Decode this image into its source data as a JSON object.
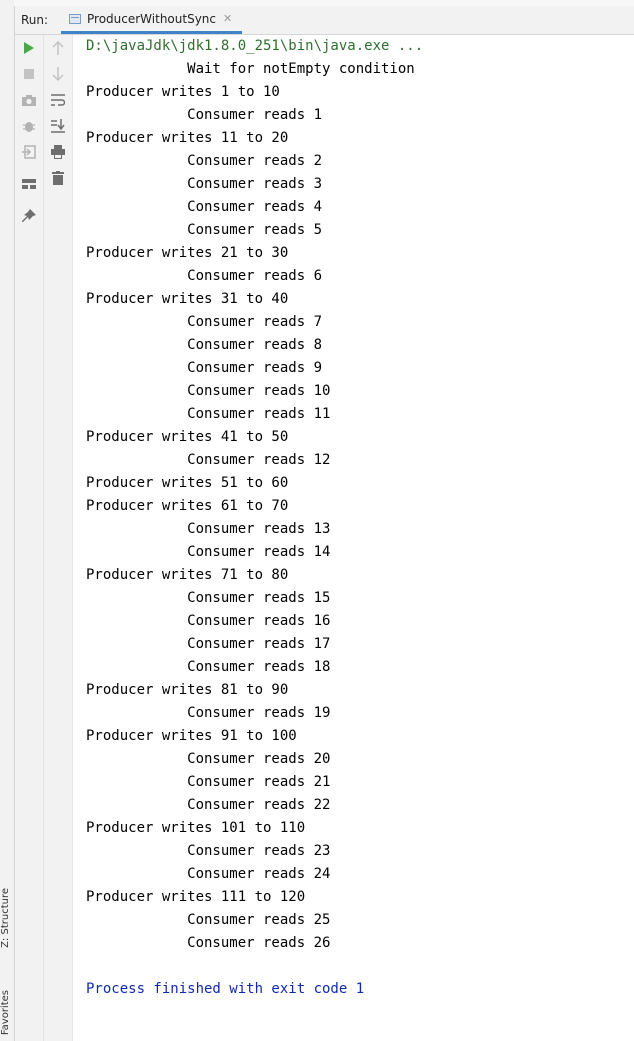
{
  "side_tabs": {
    "structure": "Z: Structure",
    "favorites": "Favorites"
  },
  "header": {
    "run_label": "Run:",
    "tab_label": "ProducerWithoutSync"
  },
  "toolbar": {
    "primary": [
      "run-icon",
      "stop-icon",
      "camera-icon",
      "debug-icon",
      "exit-icon",
      "layout-icon",
      "pin-icon"
    ],
    "secondary": [
      "arrow-up-icon",
      "arrow-down-icon",
      "soft-wrap-icon",
      "scroll-to-end-icon",
      "print-icon",
      "trash-icon"
    ]
  },
  "console": {
    "command": "D:\\javaJdk\\jdk1.8.0_251\\bin\\java.exe ...",
    "lines": [
      "            Wait for notEmpty condition",
      "Producer writes 1 to 10",
      "            Consumer reads 1",
      "Producer writes 11 to 20",
      "            Consumer reads 2",
      "            Consumer reads 3",
      "            Consumer reads 4",
      "            Consumer reads 5",
      "Producer writes 21 to 30",
      "            Consumer reads 6",
      "Producer writes 31 to 40",
      "            Consumer reads 7",
      "            Consumer reads 8",
      "            Consumer reads 9",
      "            Consumer reads 10",
      "            Consumer reads 11",
      "Producer writes 41 to 50",
      "            Consumer reads 12",
      "Producer writes 51 to 60",
      "Producer writes 61 to 70",
      "            Consumer reads 13",
      "            Consumer reads 14",
      "Producer writes 71 to 80",
      "            Consumer reads 15",
      "            Consumer reads 16",
      "            Consumer reads 17",
      "            Consumer reads 18",
      "Producer writes 81 to 90",
      "            Consumer reads 19",
      "Producer writes 91 to 100",
      "            Consumer reads 20",
      "            Consumer reads 21",
      "            Consumer reads 22",
      "Producer writes 101 to 110",
      "            Consumer reads 23",
      "            Consumer reads 24",
      "Producer writes 111 to 120",
      "            Consumer reads 25",
      "            Consumer reads 26"
    ],
    "exit_message": "Process finished with exit code 1"
  },
  "colors": {
    "command": "#2f6f2f",
    "exit_message": "#0f2aaa",
    "tab_underline": "#4083c9",
    "run_icon": "#4aa84a"
  }
}
